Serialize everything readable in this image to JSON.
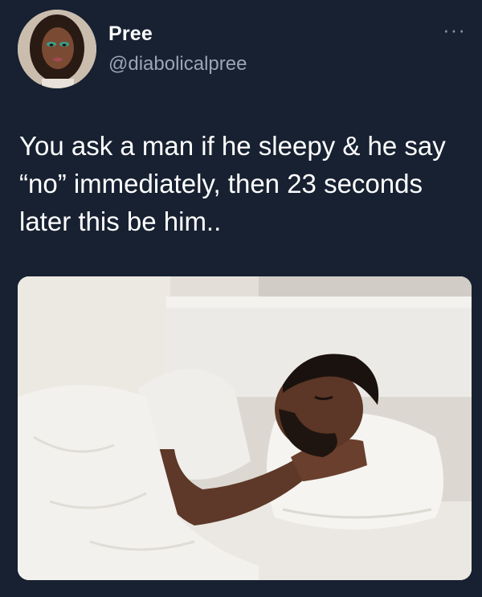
{
  "user": {
    "display_name": "Pree",
    "handle": "@diabolicalpree",
    "avatar_alt": "profile photo"
  },
  "more_icon": "···",
  "tweet": {
    "text": "You ask a man if he sleepy & he say “no” immediately, then 23 seconds later this be him.."
  },
  "media": {
    "icon": "photo-of-man-sleeping-in-bed"
  }
}
